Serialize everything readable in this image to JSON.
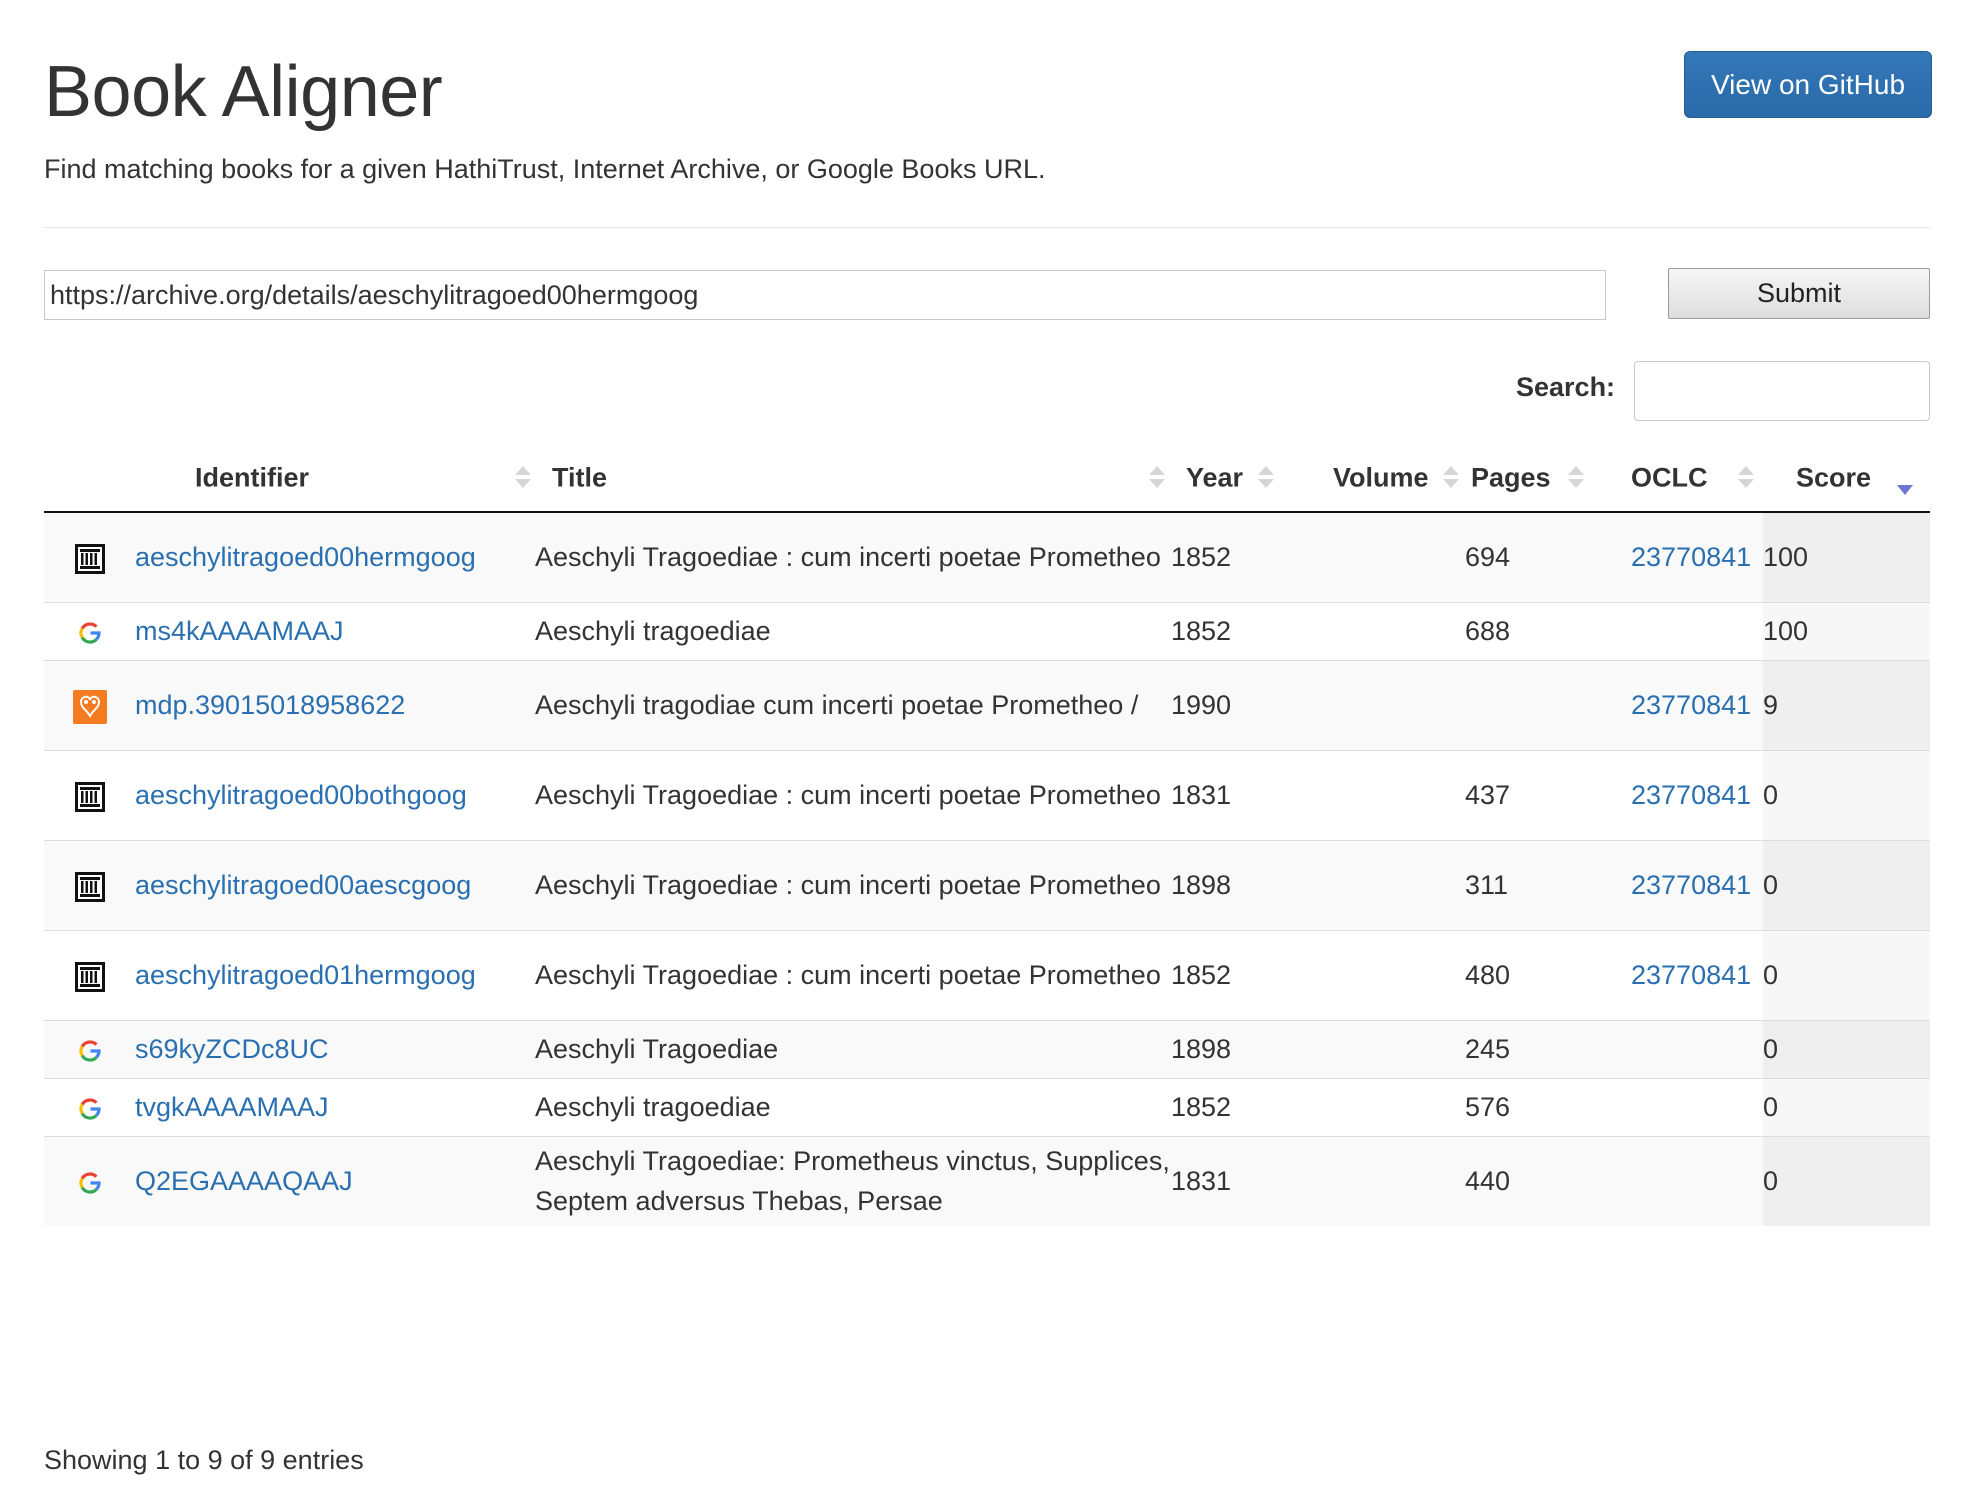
{
  "header": {
    "title": "Book Aligner",
    "subtitle": "Find matching books for a given HathiTrust, Internet Archive, or Google Books URL.",
    "github_button": "View on GitHub"
  },
  "form": {
    "url_value": "https://archive.org/details/aeschylitragoed00hermgoog",
    "submit_label": "Submit",
    "search_label": "Search:",
    "search_value": ""
  },
  "table": {
    "columns": [
      "Identifier",
      "Title",
      "Year",
      "Volume",
      "Pages",
      "OCLC",
      "Score"
    ],
    "sorted_column": "Score",
    "sort_direction": "descending",
    "rows": [
      {
        "source_icon": "internet-archive-icon",
        "identifier": "aeschylitragoed00hermgoog",
        "title": "Aeschyli Tragoediae : cum incerti poetae Prometheo",
        "year": "1852",
        "volume": "",
        "pages": "694",
        "oclc": "23770841",
        "score": "100"
      },
      {
        "source_icon": "google-icon",
        "identifier": "ms4kAAAAMAAJ",
        "title": "Aeschyli tragoediae",
        "year": "1852",
        "volume": "",
        "pages": "688",
        "oclc": "",
        "score": "100"
      },
      {
        "source_icon": "hathitrust-icon",
        "identifier": "mdp.39015018958622",
        "title": "Aeschyli tragodiae cum incerti poetae Prometheo /",
        "year": "1990",
        "volume": "",
        "pages": "",
        "oclc": "23770841",
        "score": "9"
      },
      {
        "source_icon": "internet-archive-icon",
        "identifier": "aeschylitragoed00bothgoog",
        "title": "Aeschyli Tragoediae : cum incerti poetae Prometheo",
        "year": "1831",
        "volume": "",
        "pages": "437",
        "oclc": "23770841",
        "score": "0"
      },
      {
        "source_icon": "internet-archive-icon",
        "identifier": "aeschylitragoed00aescgoog",
        "title": "Aeschyli Tragoediae : cum incerti poetae Prometheo",
        "year": "1898",
        "volume": "",
        "pages": "311",
        "oclc": "23770841",
        "score": "0"
      },
      {
        "source_icon": "internet-archive-icon",
        "identifier": "aeschylitragoed01hermgoog",
        "title": "Aeschyli Tragoediae : cum incerti poetae Prometheo",
        "year": "1852",
        "volume": "",
        "pages": "480",
        "oclc": "23770841",
        "score": "0"
      },
      {
        "source_icon": "google-icon",
        "identifier": "s69kyZCDc8UC",
        "title": "Aeschyli Tragoediae",
        "year": "1898",
        "volume": "",
        "pages": "245",
        "oclc": "",
        "score": "0"
      },
      {
        "source_icon": "google-icon",
        "identifier": "tvgkAAAAMAAJ",
        "title": "Aeschyli tragoediae",
        "year": "1852",
        "volume": "",
        "pages": "576",
        "oclc": "",
        "score": "0"
      },
      {
        "source_icon": "google-icon",
        "identifier": "Q2EGAAAAQAAJ",
        "title": "Aeschyli Tragoediae: Prometheus vinctus, Supplices, Septem adversus Thebas, Persae",
        "year": "1831",
        "volume": "",
        "pages": "440",
        "oclc": "",
        "score": "0"
      }
    ]
  },
  "footer": {
    "info": "Showing 1 to 9 of 9 entries"
  },
  "colors": {
    "link": "#2a6fb0",
    "github_button": "#3071b0",
    "sort_active": "#6f76d4",
    "hathitrust_orange": "#f47b20"
  }
}
